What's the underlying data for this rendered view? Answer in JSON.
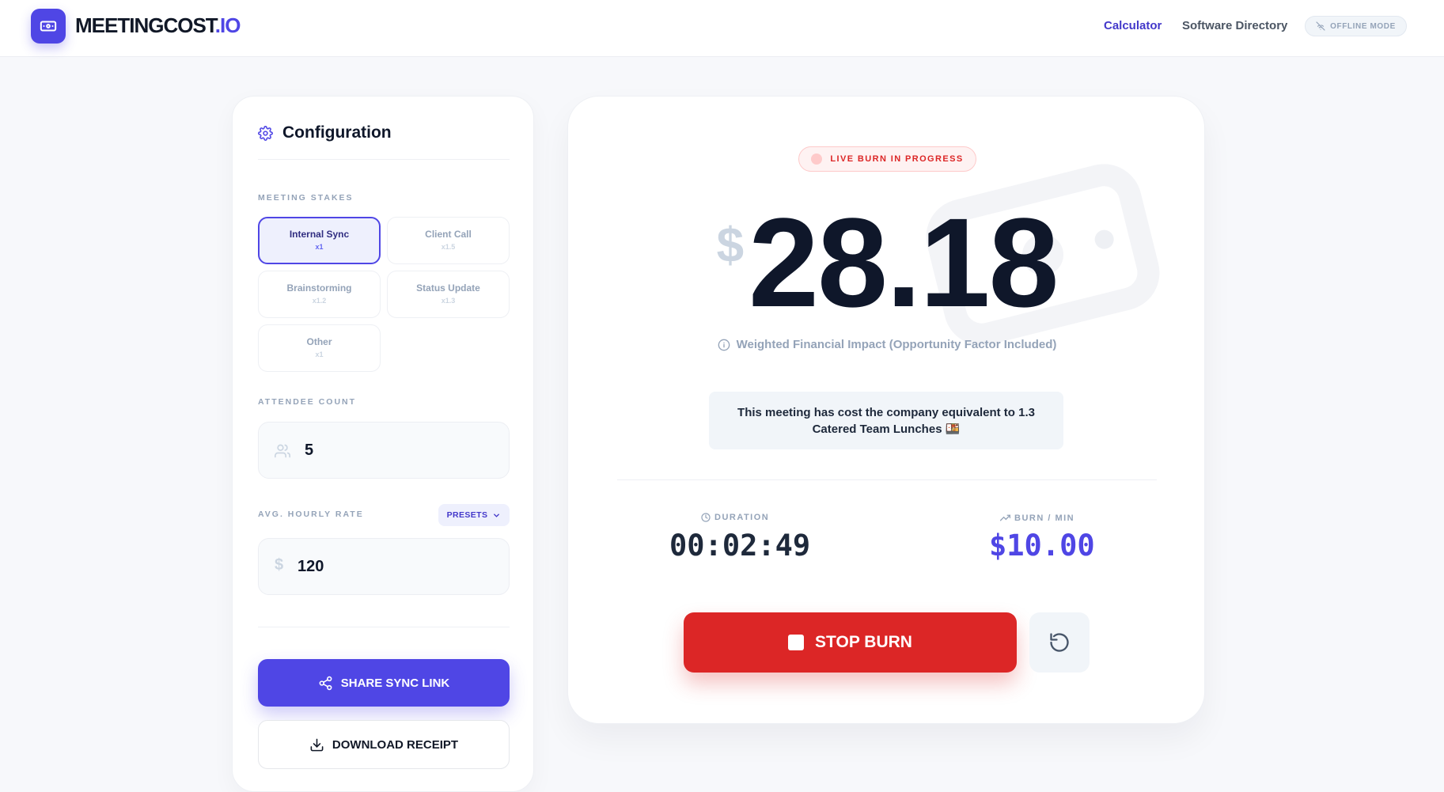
{
  "header": {
    "logo_main": "MEETINGCOST",
    "logo_accent": ".IO",
    "nav": [
      {
        "label": "Calculator",
        "active": true
      },
      {
        "label": "Software Directory",
        "active": false
      }
    ],
    "offline_label": "OFFLINE MODE"
  },
  "config": {
    "title": "Configuration",
    "stakes_label": "MEETING STAKES",
    "stakes": [
      {
        "name": "Internal Sync",
        "multiplier": "x1",
        "selected": true
      },
      {
        "name": "Client Call",
        "multiplier": "x1.5",
        "selected": false
      },
      {
        "name": "Brainstorming",
        "multiplier": "x1.2",
        "selected": false
      },
      {
        "name": "Status Update",
        "multiplier": "x1.3",
        "selected": false
      },
      {
        "name": "Other",
        "multiplier": "x1",
        "selected": false
      }
    ],
    "attendee_label": "ATTENDEE COUNT",
    "attendee_count": "5",
    "rate_label": "AVG. HOURLY RATE",
    "presets_label": "PRESETS",
    "rate_symbol": "$",
    "hourly_rate": "120",
    "share_label": "SHARE SYNC LINK",
    "download_label": "DOWNLOAD RECEIPT"
  },
  "main": {
    "live_label": "LIVE BURN IN PROGRESS",
    "currency_symbol": "$",
    "cost": "28.18",
    "impact_label": "Weighted Financial Impact (Opportunity Factor Included)",
    "equivalent": "This meeting has cost the company equivalent to 1.3 Catered Team Lunches 🍱",
    "duration_label": "DURATION",
    "duration": "00:02:49",
    "burn_label": "BURN / MIN",
    "burn_rate": "$10.00",
    "stop_label": "STOP BURN"
  },
  "colors": {
    "accent": "#4f46e5",
    "danger": "#dc2626",
    "text": "#0f172a",
    "muted": "#94a3b8"
  },
  "icons": {
    "logo": "banknote-icon",
    "offline": "wifi-off-icon",
    "config": "gear-icon",
    "attendees": "users-icon",
    "rate": "dollar-icon",
    "presets": "chevron-down-icon",
    "share": "share-icon",
    "download": "download-icon",
    "impact": "info-icon",
    "duration": "clock-icon",
    "burn": "trending-up-icon",
    "stop": "stop-icon",
    "reset": "reset-icon",
    "watermark": "banknote-icon"
  }
}
